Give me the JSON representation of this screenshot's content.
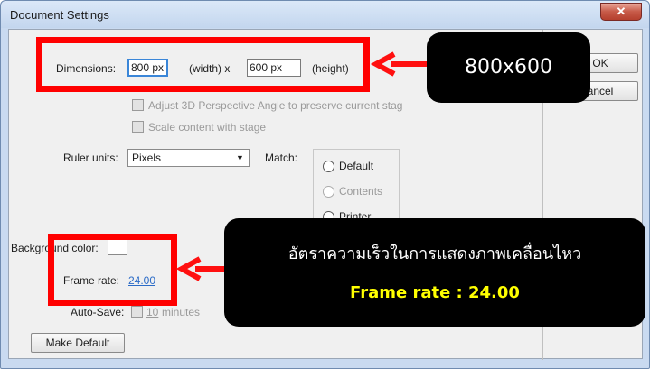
{
  "window": {
    "title": "Document Settings",
    "close_glyph": "✕"
  },
  "dimensions": {
    "label": "Dimensions:",
    "width_value": "800 px",
    "width_suffix": "(width) x",
    "height_value": "600 px",
    "height_suffix": "(height)"
  },
  "options": {
    "adjust_3d": "Adjust 3D Perspective Angle to preserve current stag",
    "scale_content": "Scale content with stage"
  },
  "ruler": {
    "label": "Ruler units:",
    "value": "Pixels"
  },
  "match": {
    "label": "Match:",
    "options": [
      "Default",
      "Contents",
      "Printer"
    ]
  },
  "background": {
    "label": "Background color:"
  },
  "frame_rate": {
    "label": "Frame rate:",
    "value": "24.00"
  },
  "auto_save": {
    "label": "Auto-Save:",
    "value": "10",
    "unit": "minutes"
  },
  "buttons": {
    "ok": "OK",
    "cancel": "ancel",
    "make_default": "Make Default"
  },
  "annotations": {
    "dimension_callout": "800x600",
    "frame_rate_callout_thai": "อัตราความเร็วในการแสดงภาพเคลื่อนไหว",
    "frame_rate_callout_value": "Frame rate : 24.00"
  },
  "colors": {
    "highlight_red": "#ff0000",
    "callout_bg": "#000000",
    "callout_accent": "#ffff00",
    "link_blue": "#2b6bc7"
  }
}
